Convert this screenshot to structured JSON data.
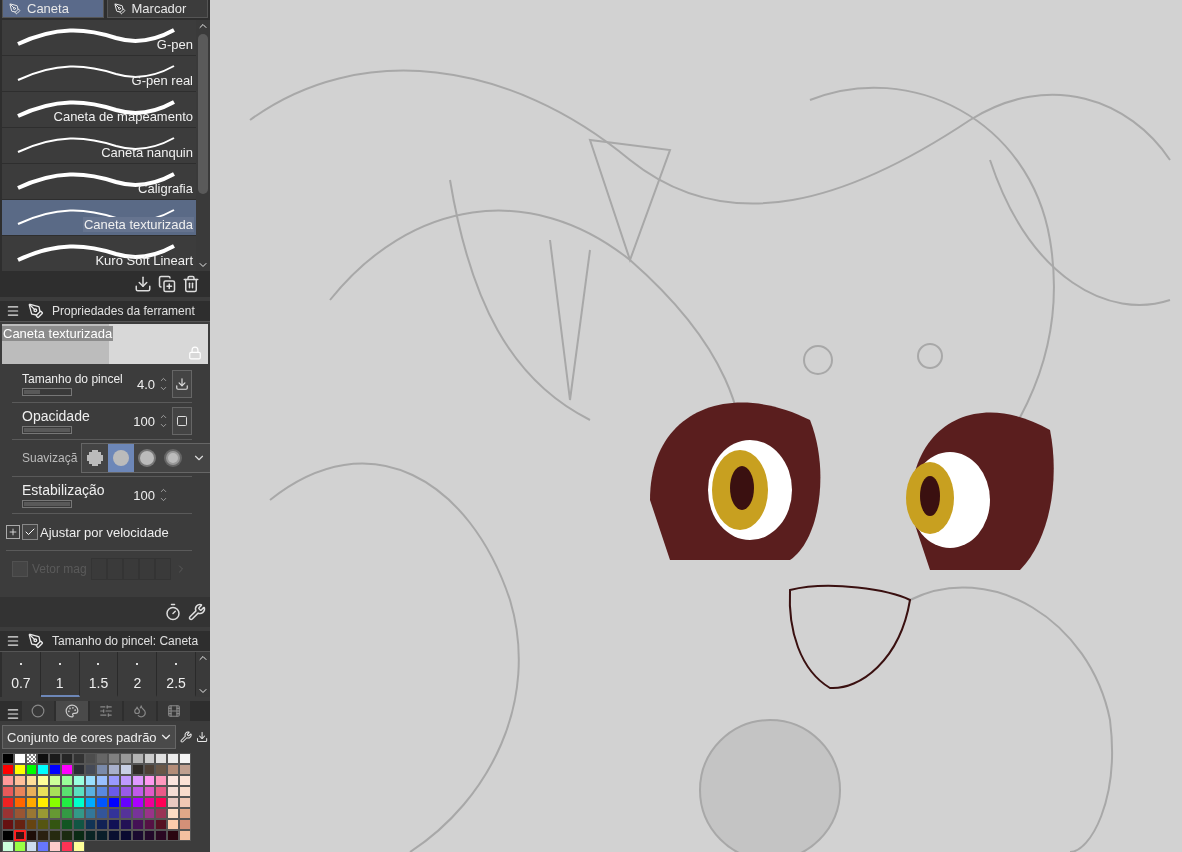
{
  "tool_tabs": [
    {
      "label": "Caneta",
      "selected": true
    },
    {
      "label": "Marcador",
      "selected": false
    }
  ],
  "brushes": [
    {
      "label": "G-pen",
      "selected": false
    },
    {
      "label": "G-pen real",
      "selected": false
    },
    {
      "label": "Caneta de mapeamento",
      "selected": false
    },
    {
      "label": "Caneta nanquin",
      "selected": false
    },
    {
      "label": "Caligrafia",
      "selected": false
    },
    {
      "label": "Caneta texturizada",
      "selected": true
    },
    {
      "label": "Kuro Soft Lineart",
      "selected": false
    }
  ],
  "tool_properties": {
    "title": "Propriedades da ferrament",
    "preview_label": "Caneta texturizada",
    "rows": [
      {
        "kind": "slider",
        "label": "Tamanho do pincel",
        "value": "4.0",
        "level": 0.35,
        "small": true,
        "button": {
          "kind": "download"
        }
      },
      {
        "kind": "slider",
        "label": "Opacidade",
        "value": "100",
        "level": 1,
        "small": false,
        "button": {
          "kind": "square"
        }
      },
      {
        "kind": "options",
        "label": "Suavizaçã",
        "options": [
          {
            "kind": "pixel",
            "selected": false
          },
          {
            "kind": "solid",
            "selected": true
          },
          {
            "kind": "soft",
            "selected": false
          },
          {
            "kind": "softer",
            "selected": false
          }
        ]
      },
      {
        "kind": "slider",
        "label": "Estabilização",
        "value": "100",
        "level": 1,
        "small": false
      },
      {
        "kind": "checkbox",
        "label": "Ajustar por velocidade",
        "checked": true
      },
      {
        "kind": "vector",
        "label": "Vetor mag",
        "disabled": true
      }
    ]
  },
  "brush_size": {
    "title": "Tamanho do pincel: Caneta",
    "sizes": [
      {
        "label": "0.7",
        "selected": false
      },
      {
        "label": "1",
        "selected": true
      },
      {
        "label": "1.5",
        "selected": false
      },
      {
        "label": "2",
        "selected": false
      },
      {
        "label": "2.5",
        "selected": false
      }
    ]
  },
  "color_set": {
    "tabs": [
      {
        "kind": "wheel",
        "selected": false
      },
      {
        "kind": "swatches",
        "selected": true
      },
      {
        "kind": "sliders",
        "selected": false
      },
      {
        "kind": "mix",
        "selected": false
      },
      {
        "kind": "history",
        "selected": false
      }
    ],
    "dropdown": "Conjunto de cores padrão",
    "rows": [
      [
        {
          "color": "#000000",
          "selected": false
        },
        {
          "color": "#ffffff",
          "selected": false
        },
        {
          "kind": "transparent",
          "color": "#ffffff",
          "selected": false
        },
        {
          "color": "#0e0e0e",
          "selected": false
        },
        {
          "color": "#1a1a1a",
          "selected": false
        },
        {
          "color": "#262626",
          "selected": false
        },
        {
          "color": "#333333",
          "selected": false
        },
        {
          "color": "#4d4d4d",
          "selected": false
        },
        {
          "color": "#666666",
          "selected": false
        },
        {
          "color": "#808080",
          "selected": false
        },
        {
          "color": "#999999",
          "selected": false
        },
        {
          "color": "#b3b3b3",
          "selected": false
        },
        {
          "color": "#cccccc",
          "selected": false
        },
        {
          "color": "#e0e0e0",
          "selected": false
        },
        {
          "color": "#ebebeb",
          "selected": false
        },
        {
          "color": "#f5f5f5",
          "selected": false
        }
      ],
      [
        {
          "color": "#ff0000",
          "selected": false
        },
        {
          "color": "#ffff00",
          "selected": false
        },
        {
          "color": "#00ff00",
          "selected": false
        },
        {
          "color": "#00ffff",
          "selected": false
        },
        {
          "color": "#0000ff",
          "selected": false
        },
        {
          "color": "#ff00ff",
          "selected": false
        },
        {
          "color": "#2b2d33",
          "selected": false
        },
        {
          "color": "#454a57",
          "selected": false
        },
        {
          "color": "#7a8aaa",
          "selected": false
        },
        {
          "color": "#a8b0cc",
          "selected": false
        },
        {
          "color": "#c8d0e6",
          "selected": false
        },
        {
          "color": "#2e2a26",
          "selected": false
        },
        {
          "color": "#4d4036",
          "selected": false
        },
        {
          "color": "#695748",
          "selected": false
        },
        {
          "color": "#b38c78",
          "selected": false
        },
        {
          "color": "#c0a090",
          "selected": false
        }
      ],
      [
        {
          "color": "#ff9999",
          "selected": false
        },
        {
          "color": "#ffbf99",
          "selected": false
        },
        {
          "color": "#ffdf99",
          "selected": false
        },
        {
          "color": "#ffff99",
          "selected": false
        },
        {
          "color": "#ccff99",
          "selected": false
        },
        {
          "color": "#99ff99",
          "selected": false
        },
        {
          "color": "#99ffdf",
          "selected": false
        },
        {
          "color": "#99dfff",
          "selected": false
        },
        {
          "color": "#99bfff",
          "selected": false
        },
        {
          "color": "#9999ff",
          "selected": false
        },
        {
          "color": "#bf99ff",
          "selected": false
        },
        {
          "color": "#df99ff",
          "selected": false
        },
        {
          "color": "#ff99ef",
          "selected": false
        },
        {
          "color": "#ff99bf",
          "selected": false
        },
        {
          "color": "#fbe4de",
          "selected": false
        },
        {
          "color": "#fbe2d6",
          "selected": false
        }
      ],
      [
        {
          "color": "#e85a5a",
          "selected": false
        },
        {
          "color": "#e8845a",
          "selected": false
        },
        {
          "color": "#e8b05a",
          "selected": false
        },
        {
          "color": "#e8e05a",
          "selected": false
        },
        {
          "color": "#a8e05a",
          "selected": false
        },
        {
          "color": "#5ae070",
          "selected": false
        },
        {
          "color": "#5ae0c0",
          "selected": false
        },
        {
          "color": "#5ab0e0",
          "selected": false
        },
        {
          "color": "#5a88e0",
          "selected": false
        },
        {
          "color": "#6a5ae8",
          "selected": false
        },
        {
          "color": "#9a5ae8",
          "selected": false
        },
        {
          "color": "#c05ae8",
          "selected": false
        },
        {
          "color": "#e05ac8",
          "selected": false
        },
        {
          "color": "#e85a88",
          "selected": false
        },
        {
          "color": "#f4dcd4",
          "selected": false
        },
        {
          "color": "#f8dccc",
          "selected": false
        }
      ],
      [
        {
          "color": "#ee2222",
          "selected": false
        },
        {
          "color": "#ff6600",
          "selected": false
        },
        {
          "color": "#ffaa00",
          "selected": false
        },
        {
          "color": "#ffee00",
          "selected": false
        },
        {
          "color": "#88ff00",
          "selected": false
        },
        {
          "color": "#22ee44",
          "selected": false
        },
        {
          "color": "#00ffcc",
          "selected": false
        },
        {
          "color": "#00aaff",
          "selected": false
        },
        {
          "color": "#0055ff",
          "selected": false
        },
        {
          "color": "#0000fe",
          "selected": false
        },
        {
          "color": "#6600ff",
          "selected": false
        },
        {
          "color": "#aa00ff",
          "selected": false
        },
        {
          "color": "#ee0099",
          "selected": false
        },
        {
          "color": "#ff0055",
          "selected": false
        },
        {
          "color": "#e8c8c0",
          "selected": false
        },
        {
          "color": "#f0c8b4",
          "selected": false
        }
      ],
      [
        {
          "color": "#993333",
          "selected": false
        },
        {
          "color": "#995533",
          "selected": false
        },
        {
          "color": "#997733",
          "selected": false
        },
        {
          "color": "#999933",
          "selected": false
        },
        {
          "color": "#669933",
          "selected": false
        },
        {
          "color": "#339944",
          "selected": false
        },
        {
          "color": "#339988",
          "selected": false
        },
        {
          "color": "#337799",
          "selected": false
        },
        {
          "color": "#335599",
          "selected": false
        },
        {
          "color": "#333399",
          "selected": false
        },
        {
          "color": "#553399",
          "selected": false
        },
        {
          "color": "#773399",
          "selected": false
        },
        {
          "color": "#993388",
          "selected": false
        },
        {
          "color": "#993355",
          "selected": false
        },
        {
          "color": "#fcdcc4",
          "selected": false
        },
        {
          "color": "#e0a888",
          "selected": false
        }
      ],
      [
        {
          "color": "#661111",
          "selected": false
        },
        {
          "color": "#662211",
          "selected": false
        },
        {
          "color": "#664411",
          "selected": false
        },
        {
          "color": "#555511",
          "selected": false
        },
        {
          "color": "#335511",
          "selected": false
        },
        {
          "color": "#115522",
          "selected": false
        },
        {
          "color": "#115544",
          "selected": false
        },
        {
          "color": "#113355",
          "selected": false
        },
        {
          "color": "#112255",
          "selected": false
        },
        {
          "color": "#111155",
          "selected": false
        },
        {
          "color": "#221155",
          "selected": false
        },
        {
          "color": "#441155",
          "selected": false
        },
        {
          "color": "#551144",
          "selected": false
        },
        {
          "color": "#551122",
          "selected": false
        },
        {
          "color": "#fcccac",
          "selected": false
        },
        {
          "color": "#d49078",
          "selected": false
        }
      ],
      [
        {
          "color": "#010101",
          "selected": false
        },
        {
          "color": "#3a1010",
          "selected": true
        },
        {
          "color": "#1e0e08",
          "selected": false
        },
        {
          "color": "#2a2010",
          "selected": false
        },
        {
          "color": "#262a10",
          "selected": false
        },
        {
          "color": "#1a2a10",
          "selected": false
        },
        {
          "color": "#0a2a14",
          "selected": false
        },
        {
          "color": "#0a2424",
          "selected": false
        },
        {
          "color": "#0a1e2a",
          "selected": false
        },
        {
          "color": "#0a1030",
          "selected": false
        },
        {
          "color": "#0a0a30",
          "selected": false
        },
        {
          "color": "#1a0a30",
          "selected": false
        },
        {
          "color": "#22082a",
          "selected": false
        },
        {
          "color": "#2a0822",
          "selected": false
        },
        {
          "color": "#2a0610",
          "selected": false
        },
        {
          "color": "#f4c0a0",
          "selected": false
        }
      ],
      [
        {
          "color": "#ccffdd",
          "selected": false
        },
        {
          "color": "#99ff44",
          "selected": false
        },
        {
          "color": "#ccddee",
          "selected": false
        },
        {
          "color": "#6677ff",
          "selected": false
        },
        {
          "color": "#ffcccc",
          "selected": false
        },
        {
          "color": "#ff3355",
          "selected": false
        },
        {
          "color": "#ffff99",
          "selected": false
        }
      ]
    ]
  }
}
